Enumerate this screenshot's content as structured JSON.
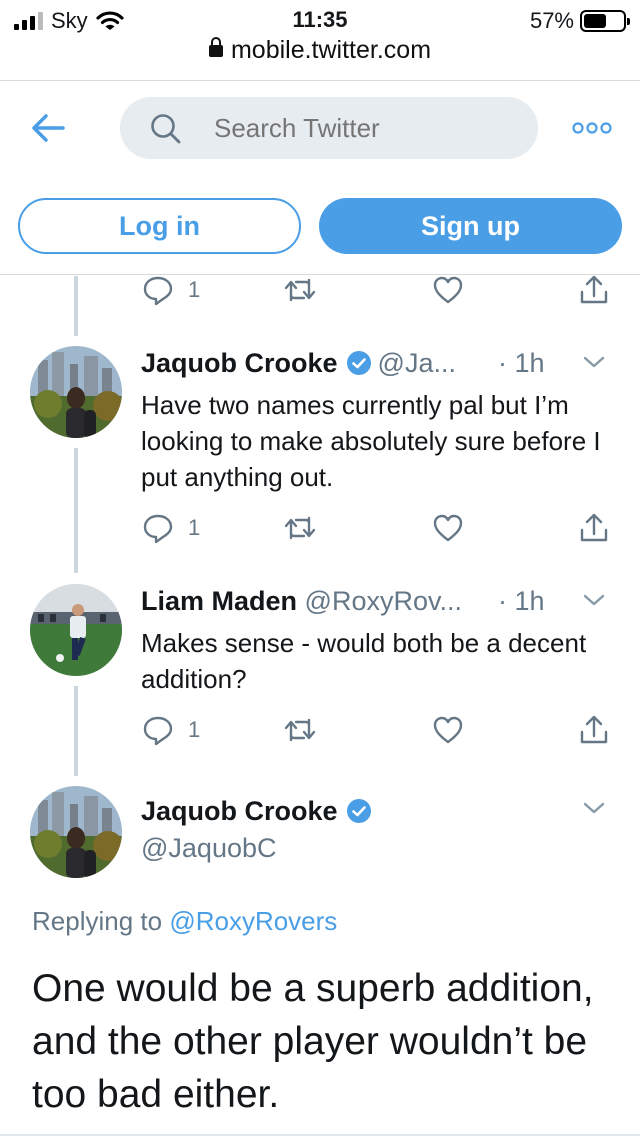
{
  "status_bar": {
    "carrier": "Sky",
    "time": "11:35",
    "battery": "57%",
    "battery_level": 0.57
  },
  "browser": {
    "url": "mobile.twitter.com"
  },
  "header": {
    "search_placeholder": "Search Twitter",
    "login_label": "Log in",
    "signup_label": "Sign up"
  },
  "top_actions": {
    "reply_count": "1"
  },
  "tweets": [
    {
      "name": "Jaquob Crooke",
      "handle": "@Ja...",
      "time": "· 1h",
      "text": "Have two names currently pal but I’m looking to make absolutely sure before I put anything out.",
      "reply_count": "1"
    },
    {
      "name": "Liam Maden",
      "handle": "@RoxyRov...",
      "time": "· 1h",
      "text": "Makes sense - would both be a decent addition?",
      "reply_count": "1"
    }
  ],
  "focused_tweet": {
    "name": "Jaquob Crooke",
    "handle": "@JaquobC",
    "replying_prefix": "Replying to",
    "replying_to": "@RoxyRovers",
    "text": "One would be a superb addition, and the other player wouldn’t be too bad either."
  },
  "colors": {
    "accent": "#4a9ee6",
    "secondary_text": "#657786",
    "thread_line": "#ccd6dd",
    "search_bg": "#e6ecf0"
  }
}
